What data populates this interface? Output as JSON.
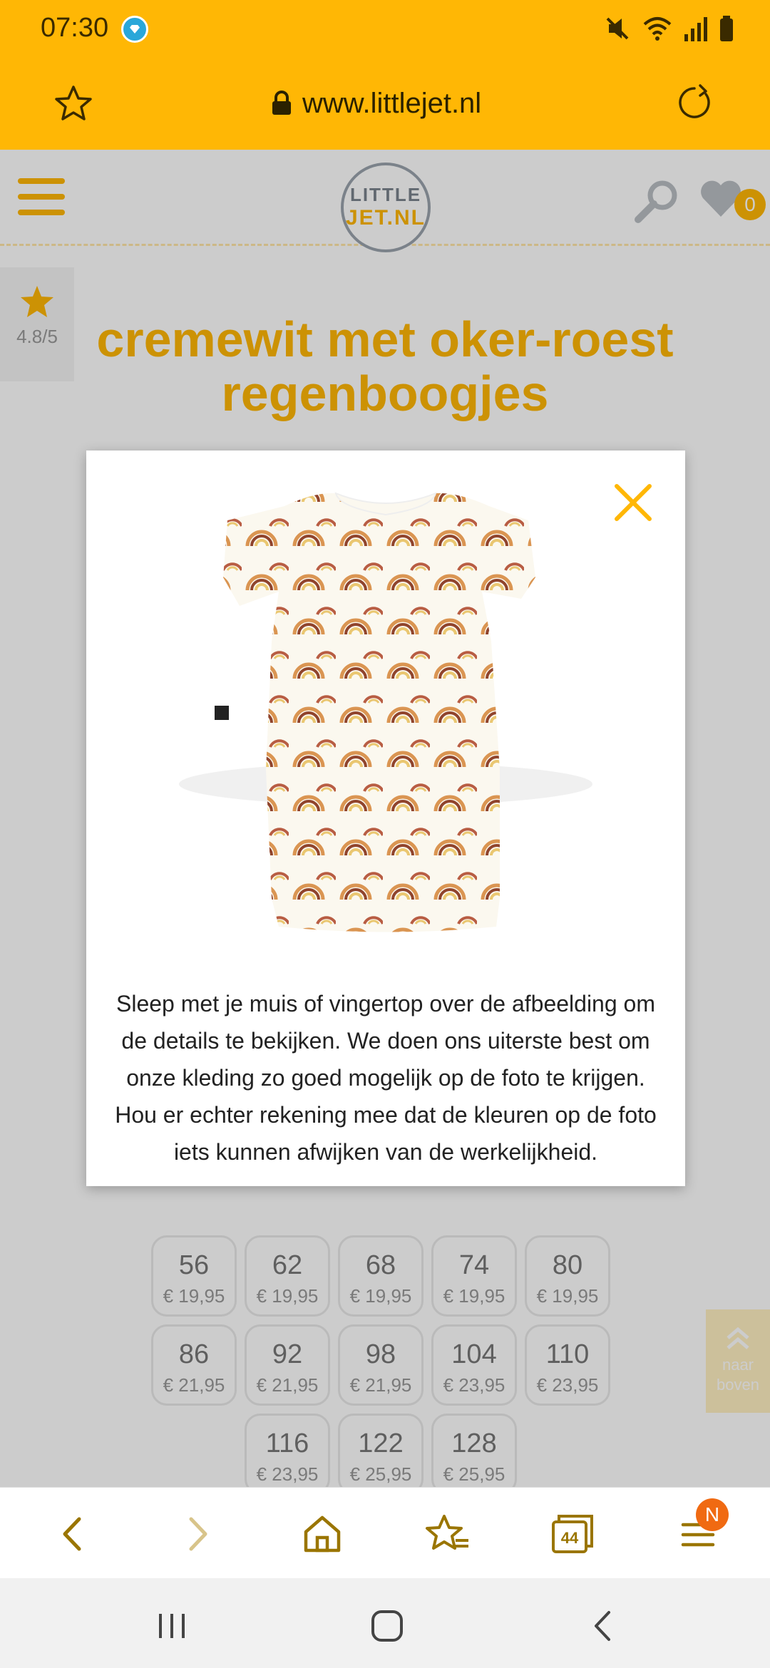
{
  "status_bar": {
    "time": "07:30",
    "icons": [
      "diamond-badge-icon",
      "mute-icon",
      "wifi-icon",
      "signal-icon",
      "battery-icon"
    ]
  },
  "url_bar": {
    "url": "www.littlejet.nl",
    "icons": [
      "star-outline-icon",
      "lock-icon",
      "reload-icon"
    ]
  },
  "site": {
    "logo_line1": "LITTLE",
    "logo_line2": "JET.NL",
    "wishlist_count": "0",
    "rating": "4.8/5",
    "product_title": "cremewit met oker-roest regenboogjes"
  },
  "modal": {
    "close_icon": "close-icon",
    "image_alt": "cremewit t-shirt met oker-roest regenboogjes",
    "description": "Sleep met je muis of vingertop over de afbeelding om de details te bekijken. We doen ons uiterste best om onze kleding zo goed mogelijk op de foto te krijgen. Hou er echter rekening mee dat de kleuren op de foto iets kunnen afwijken van de werkelijkheid."
  },
  "sizes": {
    "rows": [
      [
        {
          "size": "56",
          "price": "€ 19,95"
        },
        {
          "size": "62",
          "price": "€ 19,95"
        },
        {
          "size": "68",
          "price": "€ 19,95"
        },
        {
          "size": "74",
          "price": "€ 19,95"
        },
        {
          "size": "80",
          "price": "€ 19,95"
        }
      ],
      [
        {
          "size": "86",
          "price": "€ 21,95"
        },
        {
          "size": "92",
          "price": "€ 21,95"
        },
        {
          "size": "98",
          "price": "€ 21,95"
        },
        {
          "size": "104",
          "price": "€ 23,95"
        },
        {
          "size": "110",
          "price": "€ 23,95"
        }
      ],
      [
        {
          "size": "116",
          "price": "€ 23,95"
        },
        {
          "size": "122",
          "price": "€ 25,95"
        },
        {
          "size": "128",
          "price": "€ 25,95"
        }
      ]
    ]
  },
  "to_top": {
    "label_line1": "naar",
    "label_line2": "boven"
  },
  "browser_toolbar": {
    "tabs_count": "44",
    "menu_badge": "N",
    "icons": [
      "back-icon",
      "forward-icon",
      "home-icon",
      "bookmarks-icon",
      "tabs-icon",
      "menu-icon"
    ]
  },
  "nav_bar": {
    "icons": [
      "recents-icon",
      "home-circle-icon",
      "nav-back-icon"
    ]
  },
  "colors": {
    "accent": "#ffb705",
    "badge": "#f06a12",
    "overlay": "rgba(0,0,0,0.20)"
  }
}
